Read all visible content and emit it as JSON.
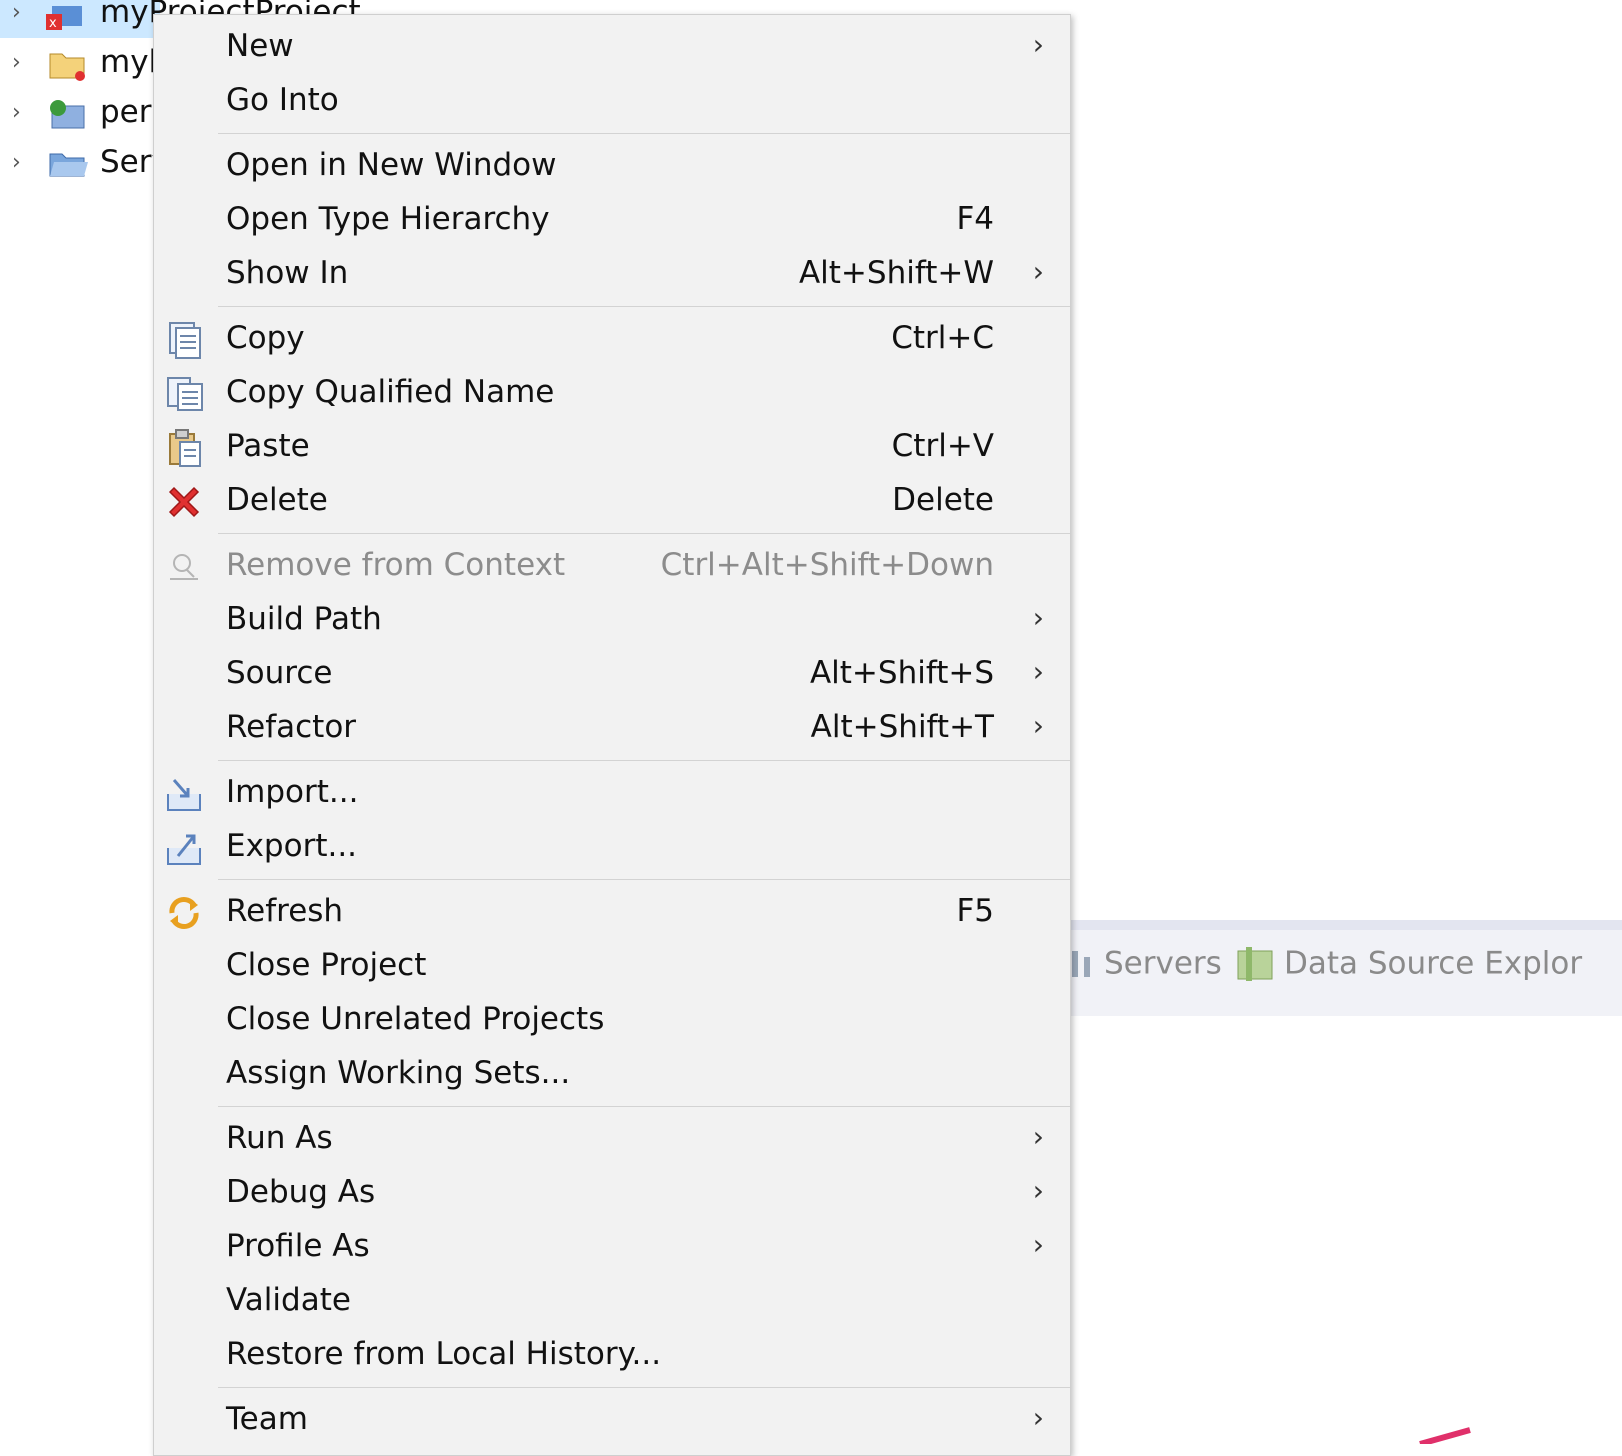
{
  "tree": {
    "items": [
      {
        "label": "myProjectProject",
        "selected": true,
        "icon": "project-error-icon"
      },
      {
        "label": "myl",
        "icon": "project-warning-icon"
      },
      {
        "label": "pers",
        "icon": "web-project-icon"
      },
      {
        "label": "Serv",
        "icon": "folder-icon"
      }
    ]
  },
  "context_menu": {
    "items": [
      {
        "label": "New",
        "shortcut": "",
        "submenu": true,
        "icon": ""
      },
      {
        "label": "Go Into",
        "shortcut": "",
        "submenu": false,
        "icon": ""
      },
      {
        "label": "Open in New Window",
        "shortcut": "",
        "submenu": false,
        "icon": ""
      },
      {
        "label": "Open Type Hierarchy",
        "shortcut": "F4",
        "submenu": false,
        "icon": ""
      },
      {
        "label": "Show In",
        "shortcut": "Alt+Shift+W",
        "submenu": true,
        "icon": ""
      },
      {
        "label": "Copy",
        "shortcut": "Ctrl+C",
        "submenu": false,
        "icon": "copy-icon"
      },
      {
        "label": "Copy Qualified Name",
        "shortcut": "",
        "submenu": false,
        "icon": "copy-qualified-name-icon"
      },
      {
        "label": "Paste",
        "shortcut": "Ctrl+V",
        "submenu": false,
        "icon": "paste-icon"
      },
      {
        "label": "Delete",
        "shortcut": "Delete",
        "submenu": false,
        "icon": "delete-icon"
      },
      {
        "label": "Remove from Context",
        "shortcut": "Ctrl+Alt+Shift+Down",
        "submenu": false,
        "icon": "remove-context-icon",
        "disabled": true
      },
      {
        "label": "Build Path",
        "shortcut": "",
        "submenu": true,
        "icon": ""
      },
      {
        "label": "Source",
        "shortcut": "Alt+Shift+S",
        "submenu": true,
        "icon": ""
      },
      {
        "label": "Refactor",
        "shortcut": "Alt+Shift+T",
        "submenu": true,
        "icon": ""
      },
      {
        "label": "Import...",
        "shortcut": "",
        "submenu": false,
        "icon": "import-icon"
      },
      {
        "label": "Export...",
        "shortcut": "",
        "submenu": false,
        "icon": "export-icon"
      },
      {
        "label": "Refresh",
        "shortcut": "F5",
        "submenu": false,
        "icon": "refresh-icon"
      },
      {
        "label": "Close Project",
        "shortcut": "",
        "submenu": false,
        "icon": ""
      },
      {
        "label": "Close Unrelated Projects",
        "shortcut": "",
        "submenu": false,
        "icon": ""
      },
      {
        "label": "Assign Working Sets...",
        "shortcut": "",
        "submenu": false,
        "icon": ""
      },
      {
        "label": "Run As",
        "shortcut": "",
        "submenu": true,
        "icon": ""
      },
      {
        "label": "Debug As",
        "shortcut": "",
        "submenu": true,
        "icon": ""
      },
      {
        "label": "Profile As",
        "shortcut": "",
        "submenu": true,
        "icon": ""
      },
      {
        "label": "Validate",
        "shortcut": "",
        "submenu": false,
        "icon": ""
      },
      {
        "label": "Restore from Local History...",
        "shortcut": "",
        "submenu": false,
        "icon": ""
      },
      {
        "label": "Team",
        "shortcut": "",
        "submenu": true,
        "icon": ""
      }
    ],
    "submenu_glyph": "›"
  },
  "views": {
    "tabs": [
      {
        "label": "Servers",
        "icon": "servers-icon"
      },
      {
        "label": "Data Source Explor",
        "icon": "data-source-explorer-icon"
      }
    ]
  },
  "colors": {
    "menu_bg": "#f2f2f2",
    "selection": "#cce8ff",
    "delete_red": "#e03030",
    "refresh_orange": "#e8a020"
  }
}
